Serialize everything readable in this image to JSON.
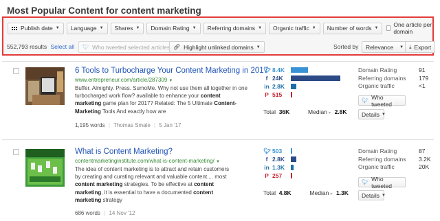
{
  "page": {
    "title": "Most Popular Content for content marketing"
  },
  "filters": {
    "buttons": [
      "Publish date",
      "Language",
      "Shares",
      "Domain Rating",
      "Referring domains",
      "Organic traffic",
      "Number of words"
    ],
    "one_article_label": "One article per domain"
  },
  "toolbar": {
    "results_text": "552,793 results",
    "select_all": "Select all",
    "who_tweeted_selected": "Who tweeted selected articles",
    "highlight_unlinked": "Highlight unlinked domains",
    "sorted_by_label": "Sorted by",
    "sort_value": "Relevance",
    "export_label": "Export"
  },
  "labels": {
    "total": "Total",
    "median": "Median",
    "domain_rating": "Domain Rating",
    "referring_domains": "Referring domains",
    "organic_traffic": "Organic traffic",
    "who_tweeted": "Who tweeted",
    "details": "Details"
  },
  "icons": {
    "twitter": "twitter-icon",
    "facebook": "facebook-icon",
    "linkedin": "linkedin-icon",
    "pinterest": "pinterest-icon"
  },
  "colors": {
    "accent_blue": "#2255b8",
    "url_green": "#3a8a3a",
    "twitter": "#3a92d6",
    "facebook": "#2b4a86",
    "linkedin": "#1a6ea8",
    "pinterest": "#c8202e",
    "highlight_border": "#e33a3a"
  },
  "articles": [
    {
      "title": "6 Tools to Turbocharge Your Content Marketing in 2017",
      "url": "www.entrepreneur.com/article/287309",
      "snippet_lines": [
        [
          {
            "t": "Buffer. Almighty. Press. SumoMe. Why not use them all together in one",
            "b": false
          }
        ],
        [
          {
            "t": "turbocharged work flow? available to enhance your ",
            "b": false
          },
          {
            "t": "content",
            "b": true
          }
        ],
        [
          {
            "t": "marketing",
            "b": true
          },
          {
            "t": " game plan for 2017? Related:  The 5 Ultimate ",
            "b": false
          },
          {
            "t": "Content-",
            "b": true
          }
        ],
        [
          {
            "t": "Marketing",
            "b": true
          },
          {
            "t": " Tools And exactly how are",
            "b": false
          }
        ]
      ],
      "words": "1,195 words",
      "author": "Thomas Smale",
      "date": "5 Jan '17",
      "shares": {
        "twitter": "8.4K",
        "facebook": "24K",
        "linkedin": "2.8K",
        "pinterest": "515"
      },
      "share_fraction": {
        "twitter": 0.35,
        "facebook": 1.0,
        "linkedin": 0.117,
        "pinterest": 0.021
      },
      "total": "36K",
      "median": "2.8K",
      "domain_rating": "91",
      "referring_domains": "179",
      "organic_traffic": "<1"
    },
    {
      "title": "What is Content Marketing?",
      "url": "contentmarketinginstitute.com/what-is-content-marketing/",
      "snippet_lines": [
        [
          {
            "t": "The idea of content marketing is to attract and retain customers",
            "b": false
          }
        ],
        [
          {
            "t": "by creating and curating relevant and valuable content.... most",
            "b": false
          }
        ],
        [
          {
            "t": "content marketing",
            "b": true
          },
          {
            "t": " strategies. To be effective at ",
            "b": false
          },
          {
            "t": "content",
            "b": true
          }
        ],
        [
          {
            "t": "marketing",
            "b": true
          },
          {
            "t": ", it is essential to have a documented ",
            "b": false
          },
          {
            "t": "content",
            "b": true
          }
        ],
        [
          {
            "t": "marketing",
            "b": true
          },
          {
            "t": " strategy",
            "b": false
          }
        ]
      ],
      "words": "686 words",
      "author": "",
      "date": "14 Nov '12",
      "shares": {
        "twitter": "503",
        "facebook": "2.8K",
        "linkedin": "1.3K",
        "pinterest": "257"
      },
      "share_fraction": {
        "twitter": 0.021,
        "facebook": 0.117,
        "linkedin": 0.054,
        "pinterest": 0.011
      },
      "total": "4.8K",
      "median": "1.3K",
      "domain_rating": "87",
      "referring_domains": "3.2K",
      "organic_traffic": "20K"
    }
  ]
}
